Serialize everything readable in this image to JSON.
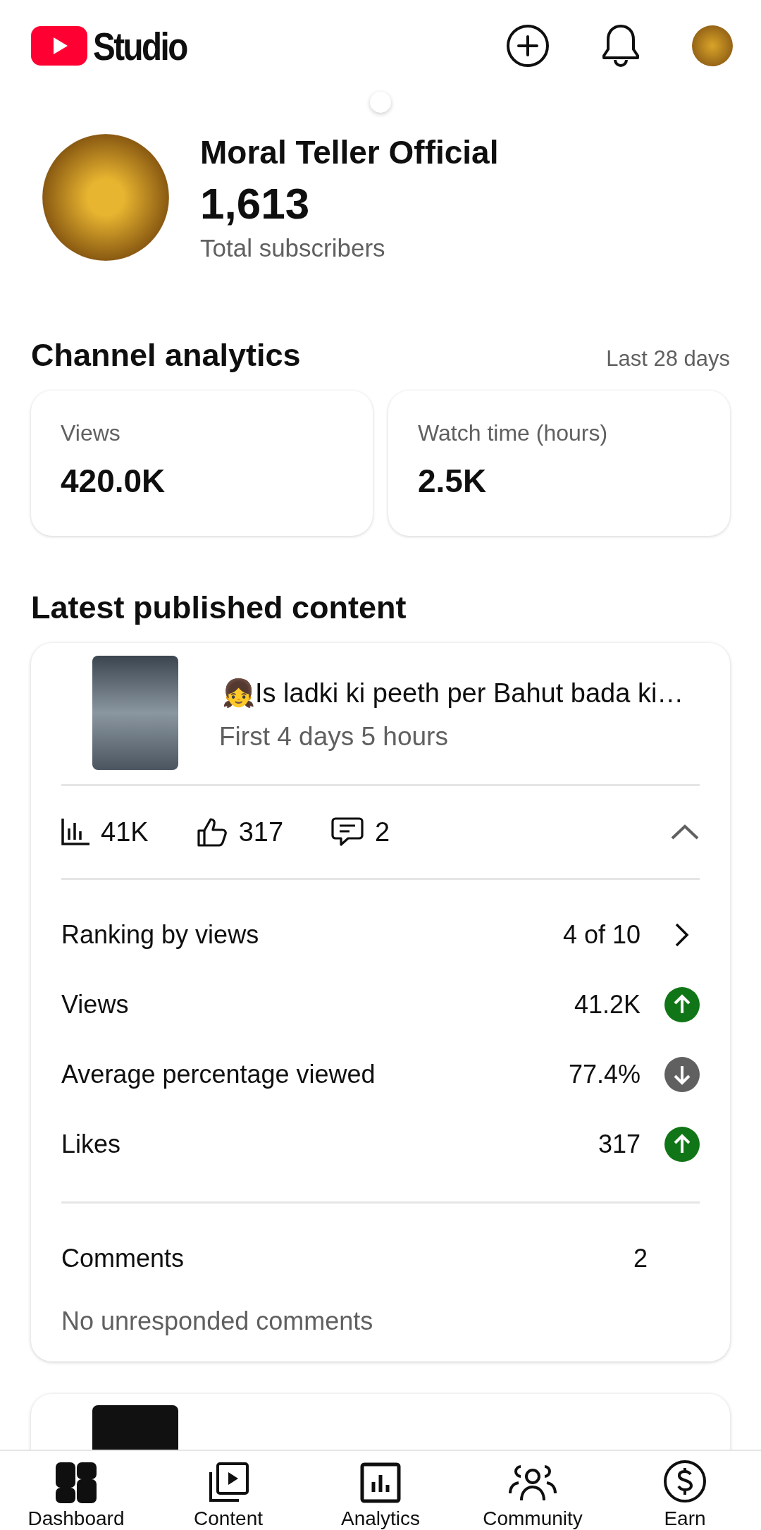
{
  "header": {
    "logo_text": "Studio"
  },
  "channel": {
    "name": "Moral Teller Official",
    "subscribers": "1,613",
    "subscribers_label": "Total subscribers"
  },
  "analytics": {
    "title": "Channel analytics",
    "period": "Last 28 days",
    "cards": [
      {
        "label": "Views",
        "value": "420.0K"
      },
      {
        "label": "Watch time (hours)",
        "value": "2.5K"
      }
    ]
  },
  "latest": {
    "title": "Latest published content",
    "video": {
      "title": "👧Is ladki ki peeth per Bahut bada ki…",
      "period": "First 4 days 5 hours",
      "views": "41K",
      "likes": "317",
      "comments": "2",
      "expanded": true,
      "rows": [
        {
          "kind": "link",
          "label": "Ranking by views",
          "value": "4 of 10"
        },
        {
          "kind": "up",
          "label": "Views",
          "value": "41.2K"
        },
        {
          "kind": "down",
          "label": "Average percentage viewed",
          "value": "77.4%"
        },
        {
          "kind": "up",
          "label": "Likes",
          "value": "317"
        }
      ],
      "comments_label": "Comments",
      "comments_count": "2",
      "comments_note": "No unresponded comments"
    }
  },
  "nav": [
    {
      "label": "Dashboard",
      "selected": true
    },
    {
      "label": "Content",
      "selected": false
    },
    {
      "label": "Analytics",
      "selected": false
    },
    {
      "label": "Community",
      "selected": false
    },
    {
      "label": "Earn",
      "selected": false
    }
  ]
}
